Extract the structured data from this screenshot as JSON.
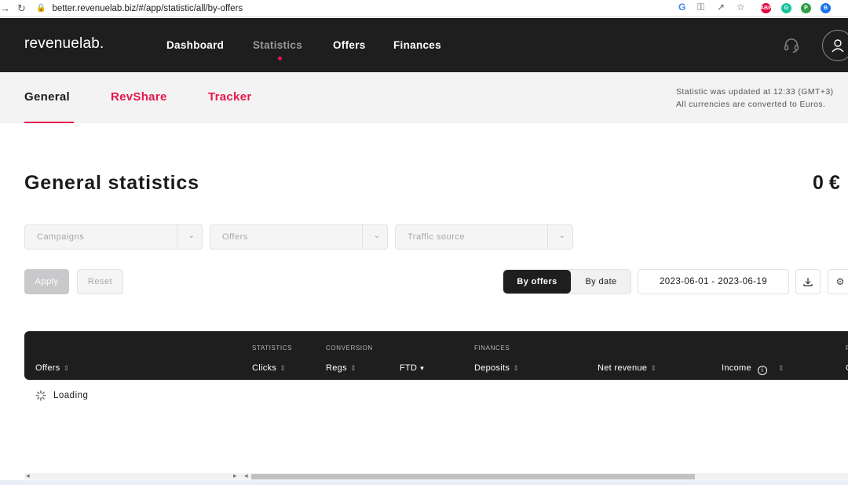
{
  "browser": {
    "url": "better.revenuelab.biz/#/app/statistic/all/by-offers",
    "back_icon": "arrow-left-icon",
    "forward_icon": "arrow-right-icon",
    "reload_icon": "reload-icon",
    "extensions": [
      "ABP",
      "G",
      "P",
      "B"
    ]
  },
  "header": {
    "logo": "revenuelab.",
    "nav": [
      {
        "label": "Dashboard",
        "active": false
      },
      {
        "label": "Statistics",
        "active": true
      },
      {
        "label": "Offers",
        "active": false
      },
      {
        "label": "Finances",
        "active": false
      }
    ],
    "accent": "#e5184b",
    "background": "#1e1e1e"
  },
  "subnav": {
    "tabs": [
      {
        "label": "General",
        "active": true
      },
      {
        "label": "RevShare",
        "active": false
      },
      {
        "label": "Tracker",
        "active": false
      }
    ],
    "updated_line1": "Statistic was updated at 12:33 (GMT+3)",
    "updated_line2": "All currencies are converted to Euros."
  },
  "main": {
    "title": "General statistics",
    "total": "0 €"
  },
  "filters": {
    "campaigns_placeholder": "Campaigns",
    "offers_placeholder": "Offers",
    "traffic_placeholder": "Traffic source",
    "apply_label": "Apply",
    "reset_label": "Reset"
  },
  "view": {
    "by_offers_label": "By offers",
    "by_date_label": "By date",
    "date_range": "2023-06-01 - 2023-06-19"
  },
  "table": {
    "groups": {
      "statistics": "STATISTICS",
      "conversion": "CONVERSION",
      "finances": "FINANCES",
      "cut": "F"
    },
    "columns": {
      "offers": "Offers",
      "clicks": "Clicks",
      "regs": "Regs",
      "ftd": "FTD",
      "deposits": "Deposits",
      "net_revenue": "Net revenue",
      "income": "Income",
      "cut": "C"
    },
    "loading_text": "Loading"
  }
}
